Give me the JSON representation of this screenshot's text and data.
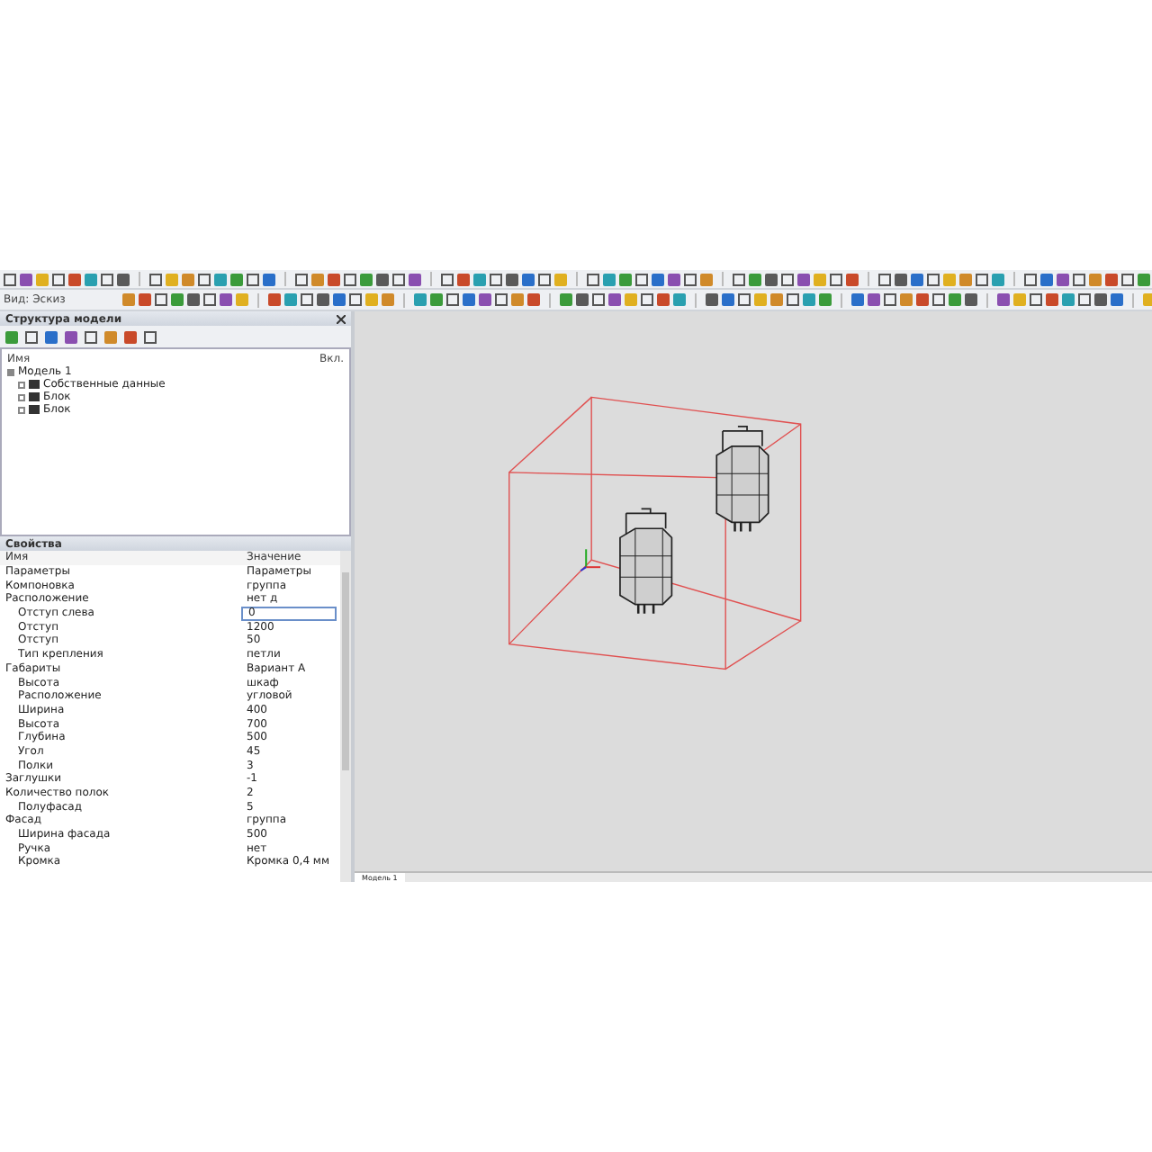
{
  "toolbar": {
    "view_label": "Вид: Эскиз"
  },
  "tree_panel": {
    "title": "Структура модели",
    "column_name": "Имя",
    "column_visible": "Вкл.",
    "items": [
      {
        "label": "Модель 1",
        "expanded": true,
        "children": [
          {
            "label": "Собственные данные",
            "expanded": false
          },
          {
            "label": "Блок",
            "expanded": false
          },
          {
            "label": "Блок",
            "expanded": false
          }
        ]
      }
    ]
  },
  "properties_panel": {
    "title": "Свойства",
    "column_name": "Имя",
    "column_value": "Значение",
    "rows": [
      {
        "name": "Параметры",
        "value": "Параметры",
        "editing": false
      },
      {
        "name": "Компоновка",
        "value": "группа",
        "editing": false
      },
      {
        "name": "Расположение",
        "value": "нет д",
        "editing": false,
        "children": [
          {
            "name": "Отступ слева",
            "value": "0",
            "editing": true
          },
          {
            "name": "Отступ",
            "value": "1200",
            "editing": false
          },
          {
            "name": "Отступ",
            "value": "50",
            "editing": false
          },
          {
            "name": "Тип крепления",
            "value": "петли",
            "editing": false
          }
        ]
      },
      {
        "name": "Габариты",
        "value": "Вариант А",
        "editing": false,
        "children": [
          {
            "name": "Высота",
            "value": "шкаф",
            "editing": false
          },
          {
            "name": "Расположение",
            "value": "угловой",
            "editing": false
          },
          {
            "name": "Ширина",
            "value": "400",
            "editing": false
          },
          {
            "name": "Высота",
            "value": "700",
            "editing": false
          },
          {
            "name": "Глубина",
            "value": "500",
            "editing": false
          },
          {
            "name": "Угол",
            "value": "45",
            "editing": false
          },
          {
            "name": "Полки",
            "value": "3",
            "editing": false
          }
        ]
      },
      {
        "name": "Заглушки",
        "value": "-1",
        "editing": false
      },
      {
        "name": "Количество полок",
        "value": "2",
        "editing": false,
        "children": [
          {
            "name": "Полуфасад",
            "value": "5",
            "editing": false
          }
        ]
      },
      {
        "name": "Фасад",
        "value": "группа",
        "editing": false,
        "children": [
          {
            "name": "Ширина фасада",
            "value": "500",
            "editing": false
          },
          {
            "name": "Ручка",
            "value": "нет",
            "editing": false
          },
          {
            "name": "Кромка",
            "value": "Кромка 0,4 мм",
            "editing": false
          }
        ]
      }
    ]
  },
  "viewport": {
    "tabs": [
      {
        "label": "Модель 1",
        "selected": true
      }
    ]
  }
}
